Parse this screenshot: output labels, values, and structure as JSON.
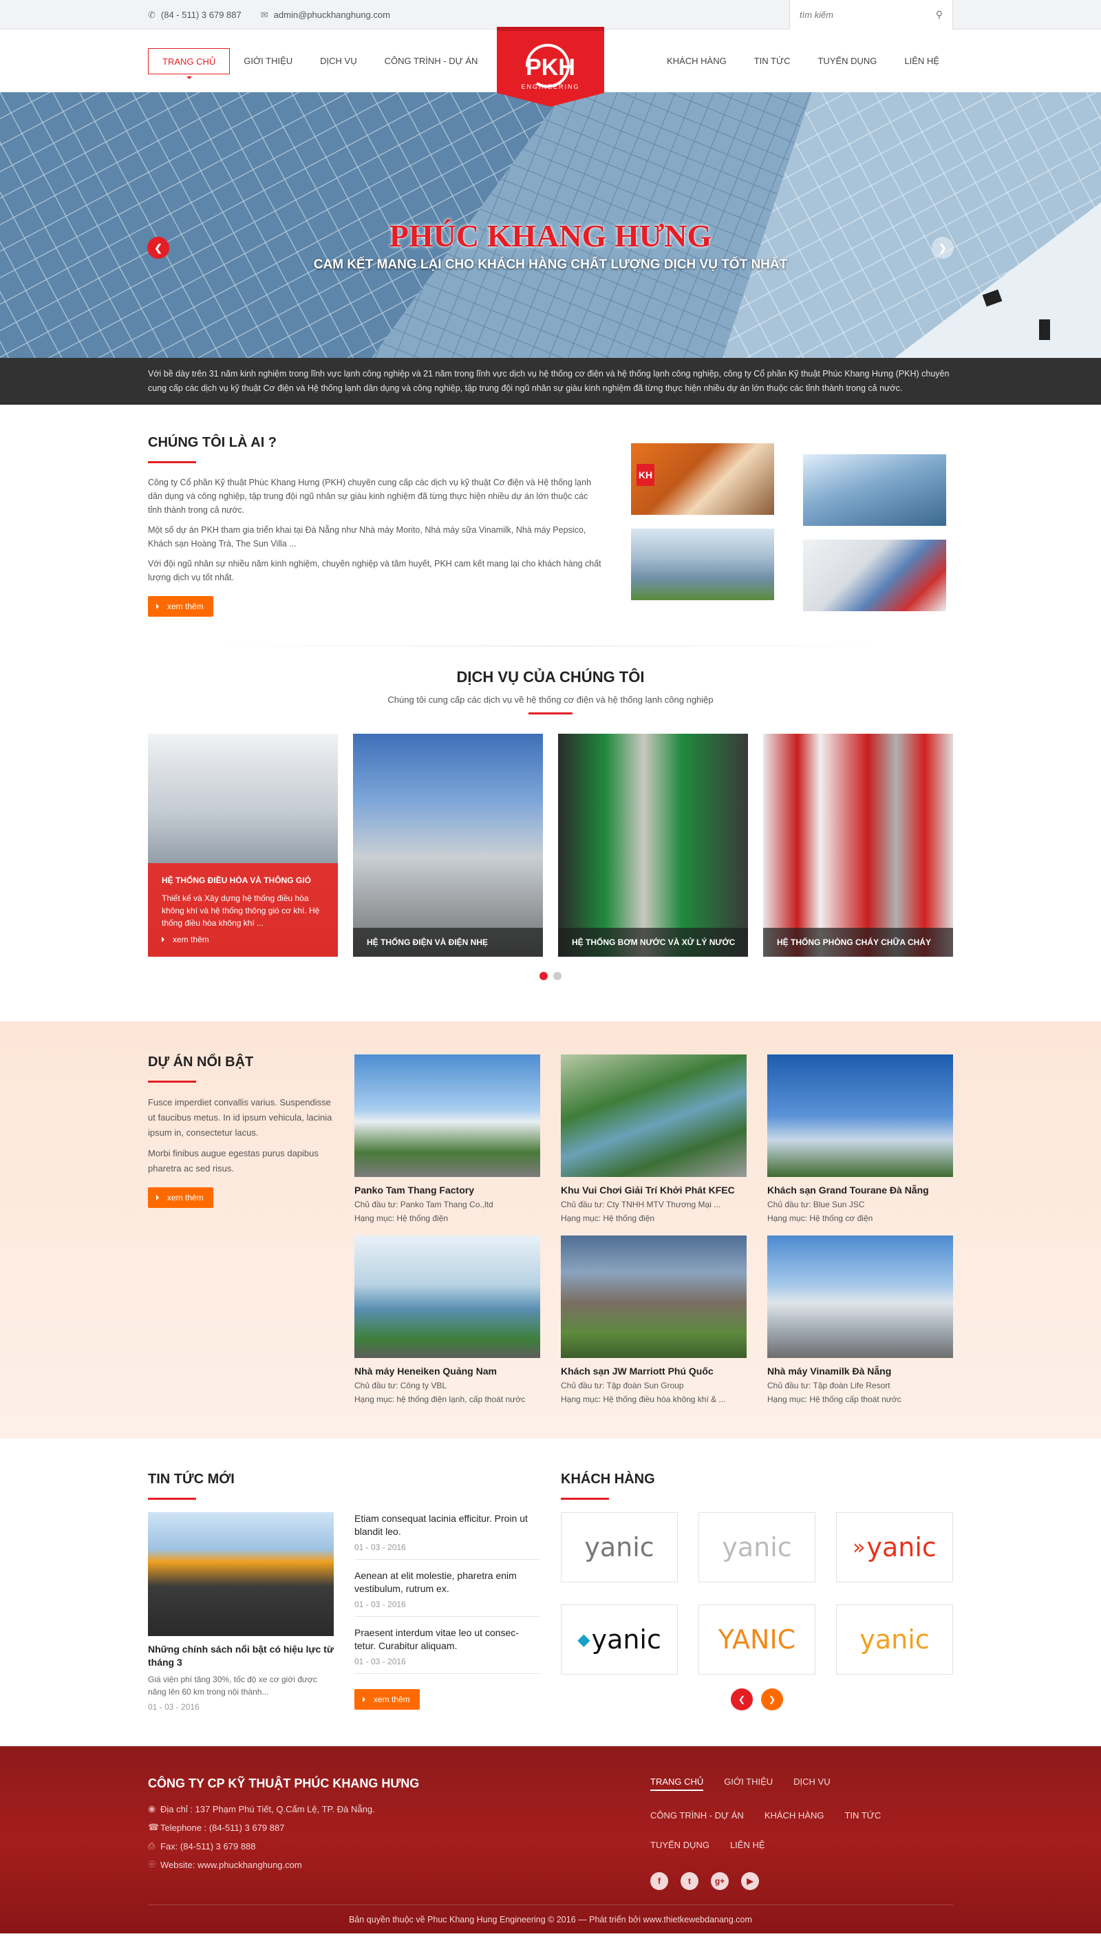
{
  "topbar": {
    "phone": "(84 - 511) 3 679 887",
    "email": "admin@phuckhanghung.com",
    "search_placeholder": "tìm kiếm"
  },
  "nav": {
    "left": [
      "TRANG CHỦ",
      "GIỚI THIỆU",
      "DỊCH VỤ",
      "CÔNG TRÌNH - DỰ ÁN"
    ],
    "right": [
      "KHÁCH HÀNG",
      "TIN TỨC",
      "TUYỂN DỤNG",
      "LIÊN HỆ"
    ],
    "logo_text": "PKH",
    "logo_sub": "ENGINEERING"
  },
  "hero": {
    "title": "PHÚC KHANG HƯNG",
    "subtitle": "CAM KẾT MANG LẠI CHO KHÁCH HÀNG CHẤT LƯỢNG DỊCH VỤ TỐT NHẤT"
  },
  "intro": "Với bề dày trên 31 năm kinh nghiệm trong lĩnh vực lạnh công nghiệp và 21 năm trong lĩnh vực dịch vụ hệ thống cơ điện và hệ thống lạnh công nghiệp, công ty Cổ phần Kỹ thuật Phúc Khang Hưng (PKH) chuyên cung cấp các dịch vụ kỹ thuật Cơ điện và Hệ thống lạnh dân dụng và công nghiệp, tập trung đội ngũ nhân sự giàu kinh nghiệm đã từng thực hiện nhiều dự án lớn thuộc các tỉnh thành trong cả nước.",
  "about": {
    "title": "CHÚNG TÔI LÀ AI ?",
    "p1": "Công ty Cổ phần Kỹ thuật Phúc Khang Hưng (PKH) chuyên cung cấp các dịch vụ kỹ thuật Cơ điện và Hệ thống lạnh dân dụng và công nghiệp, tập trung đội ngũ nhân sự giàu kinh nghiệm đã từng thực hiện nhiều dự án lớn thuộc các tỉnh thành trong cả nước.",
    "p2": "Một số dự án PKH tham gia triển khai tại Đà Nẵng như Nhà máy Morito, Nhà máy sữa Vinamilk, Nhà máy Pepsico, Khách sạn Hoàng Trà, The Sun Villa ...",
    "p3": "Với đội ngũ nhân sự nhiều năm kinh nghiệm, chuyên nghiệp và tâm huyết, PKH cam kết mang lại cho khách hàng chất lượng dịch vụ tốt nhất.",
    "button": "xem thêm"
  },
  "services": {
    "title": "DỊCH VỤ CỦA CHÚNG TÔI",
    "lead": "Chúng tôi cung cấp các dịch vụ về hệ thống cơ điện và hệ thống lạnh công nghiệp",
    "items": [
      {
        "title": "HỆ THỐNG ĐIỀU HÒA VÀ THÔNG GIÓ",
        "desc": "Thiết kế và Xây dựng hệ thống điều hòa không khí và hệ thống thông gió cơ khí. Hệ thống điều hòa không khí ...",
        "more": "xem thêm"
      },
      {
        "title": "HỆ THỐNG ĐIỆN VÀ ĐIỆN NHẸ"
      },
      {
        "title": "HỆ THỐNG BƠM NƯỚC VÀ XỬ LÝ NƯỚC"
      },
      {
        "title": "HỆ THỐNG PHÒNG CHÁY CHỮA CHÁY"
      }
    ]
  },
  "projects": {
    "title": "DỰ ÁN NỔI BẬT",
    "p1": "Fusce imperdiet convallis varius. Suspendisse ut faucibus metus. In id ipsum vehicula, lacinia ipsum in, consectetur lacus.",
    "p2": "Morbi finibus augue egestas purus dapibus pharetra ac sed risus.",
    "button": "xem thêm",
    "items": [
      {
        "name": "Panko Tam Thang Factory",
        "owner": "Chủ đầu tư: Panko Tam Thang Co.,ltd",
        "cat": "Hạng mục:  Hệ thống điện"
      },
      {
        "name": "Khu Vui Chơi Giải Trí Khởi Phát KFEC",
        "owner": "Chủ đầu tư: Cty TNHH MTV Thương Mại ...",
        "cat": "Hạng mục:  Hệ thống điện"
      },
      {
        "name": "Khách sạn Grand Tourane Đà Nẵng",
        "owner": "Chủ đầu tư: Blue Sun JSC",
        "cat": "Hạng mục:  Hệ thống cơ điện"
      },
      {
        "name": "Nhà máy Heneiken Quảng Nam",
        "owner": "Chủ đầu tư: Công ty VBL",
        "cat": "Hạng mục:  hệ thống điện lạnh, cấp thoát nước"
      },
      {
        "name": "Khách sạn JW Marriott Phú Quốc",
        "owner": "Chủ đầu tư: Tập đoàn Sun Group",
        "cat": "Hạng mục:  Hệ thống điều hòa không khí & ..."
      },
      {
        "name": "Nhà máy Vinamilk Đà Nẵng",
        "owner": "Chủ đầu tư: Tập đoàn Life Resort",
        "cat": "Hạng mục:  Hệ thống cấp thoát nước"
      }
    ]
  },
  "news": {
    "title": "TIN TỨC MỚI",
    "main": {
      "title": "Những chính sách nổi bật có hiệu lực từ tháng 3",
      "desc": "Giá viện phí tăng 30%, tốc độ xe cơ giới được nâng lên 60 km trong nội thành...",
      "date": "01 - 03 - 2016"
    },
    "items": [
      {
        "title": "Etiam consequat lacinia efficitur. Proin ut blandit leo.",
        "date": "01 - 03 - 2016"
      },
      {
        "title": "Aenean at elit molestie, pharetra enim vestibulum, rutrum ex.",
        "date": "01 - 03 - 2016"
      },
      {
        "title": "Praesent interdum vitae leo ut consec-tetur. Curabitur aliquam.",
        "date": "01 - 03 - 2016"
      }
    ],
    "button": "xem thêm"
  },
  "clients": {
    "title": "KHÁCH HÀNG",
    "logos": [
      "yanic",
      "yanic",
      "yanic",
      "yanic",
      "YANIC",
      "yanic"
    ]
  },
  "footer": {
    "company": "CÔNG TY CP KỸ THUẬT PHÚC KHANG HƯNG",
    "address": "Địa chỉ : 137 Phạm Phú Tiết, Q.Cẩm Lệ, TP. Đà Nẵng.",
    "phone": "Telephone : (84-511) 3 679 887",
    "fax": "Fax: (84-511) 3 679 888",
    "website": "Website: www.phuckhanghung.com",
    "nav": [
      "TRANG CHỦ",
      "GIỚI THIỆU",
      "DỊCH VỤ",
      "CÔNG TRÌNH - DỰ ÁN",
      "KHÁCH HÀNG",
      "TIN TỨC",
      "TUYỂN DỤNG",
      "LIÊN HỆ"
    ],
    "copyright": "Bản quyền thuộc về Phuc Khang Hung Engineering © 2016   —   Phát triển bởi www.thietkewebdanang.com"
  }
}
